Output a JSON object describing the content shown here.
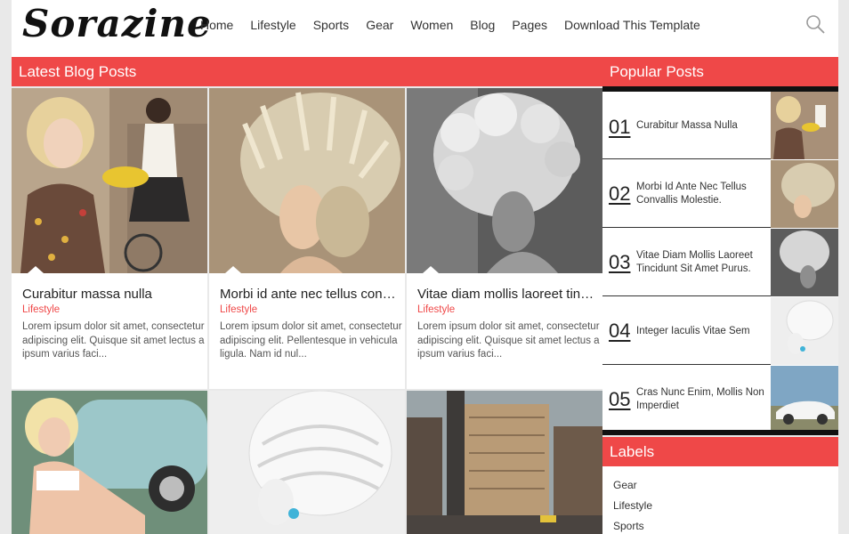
{
  "header": {
    "logo": "Sorazine",
    "nav": [
      "Home",
      "Lifestyle",
      "Sports",
      "Gear",
      "Women",
      "Blog",
      "Pages",
      "Download This Template"
    ]
  },
  "latest": {
    "heading": "Latest Blog Posts",
    "posts": [
      {
        "title": "Curabitur massa nulla",
        "category": "Lifestyle",
        "excerpt": "Lorem ipsum dolor sit amet, consectetur adipiscing elit. Quisque sit amet lectus a ipsum varius faci..."
      },
      {
        "title": "Morbi id ante nec tellus convallis",
        "category": "Lifestyle",
        "excerpt": "Lorem ipsum dolor sit amet, consectetur adipiscing elit. Pellentesque in vehicula ligula. Nam id nul..."
      },
      {
        "title": "Vitae diam mollis laoreet tincidunt",
        "category": "Lifestyle",
        "excerpt": "Lorem ipsum dolor sit amet, consectetur adipiscing elit. Quisque sit amet lectus a ipsum varius faci..."
      }
    ]
  },
  "popular": {
    "heading": "Popular Posts",
    "items": [
      {
        "num": "01",
        "title": "Curabitur Massa Nulla"
      },
      {
        "num": "02",
        "title": "Morbi Id Ante Nec Tellus Convallis Molestie."
      },
      {
        "num": "03",
        "title": "Vitae Diam Mollis Laoreet Tincidunt Sit Amet Purus."
      },
      {
        "num": "04",
        "title": "Integer Iaculis Vitae Sem"
      },
      {
        "num": "05",
        "title": "Cras Nunc Enim, Mollis Non Imperdiet"
      }
    ]
  },
  "labels": {
    "heading": "Labels",
    "items": [
      "Gear",
      "Lifestyle",
      "Sports"
    ]
  },
  "colors": {
    "accent": "#ef4848",
    "dark": "#111111"
  }
}
